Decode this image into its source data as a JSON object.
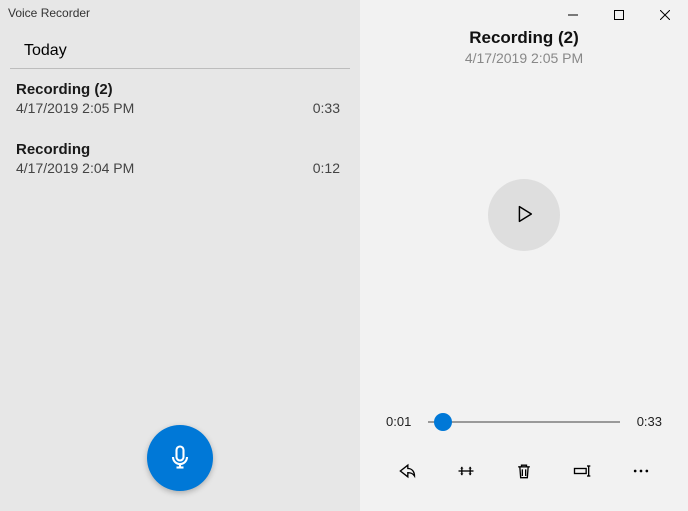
{
  "app_title": "Voice Recorder",
  "section_header": "Today",
  "recordings": [
    {
      "name": "Recording (2)",
      "datetime": "4/17/2019 2:05 PM",
      "duration": "0:33"
    },
    {
      "name": "Recording",
      "datetime": "4/17/2019 2:04 PM",
      "duration": "0:12"
    }
  ],
  "detail": {
    "title": "Recording (2)",
    "subtitle": "4/17/2019 2:05 PM"
  },
  "playback": {
    "current_time": "0:01",
    "total_time": "0:33",
    "progress_percent": 8
  },
  "icons": {
    "record": "microphone-icon",
    "play": "play-icon",
    "flag": "flag-icon",
    "share": "share-icon",
    "trim": "trim-icon",
    "delete": "trash-icon",
    "rename": "rename-icon",
    "more": "more-icon",
    "minimize": "minimize-icon",
    "maximize": "maximize-icon",
    "close": "close-icon"
  },
  "colors": {
    "accent": "#0078d7",
    "left_bg": "#e7e7e7",
    "right_bg": "#f2f2f2"
  }
}
